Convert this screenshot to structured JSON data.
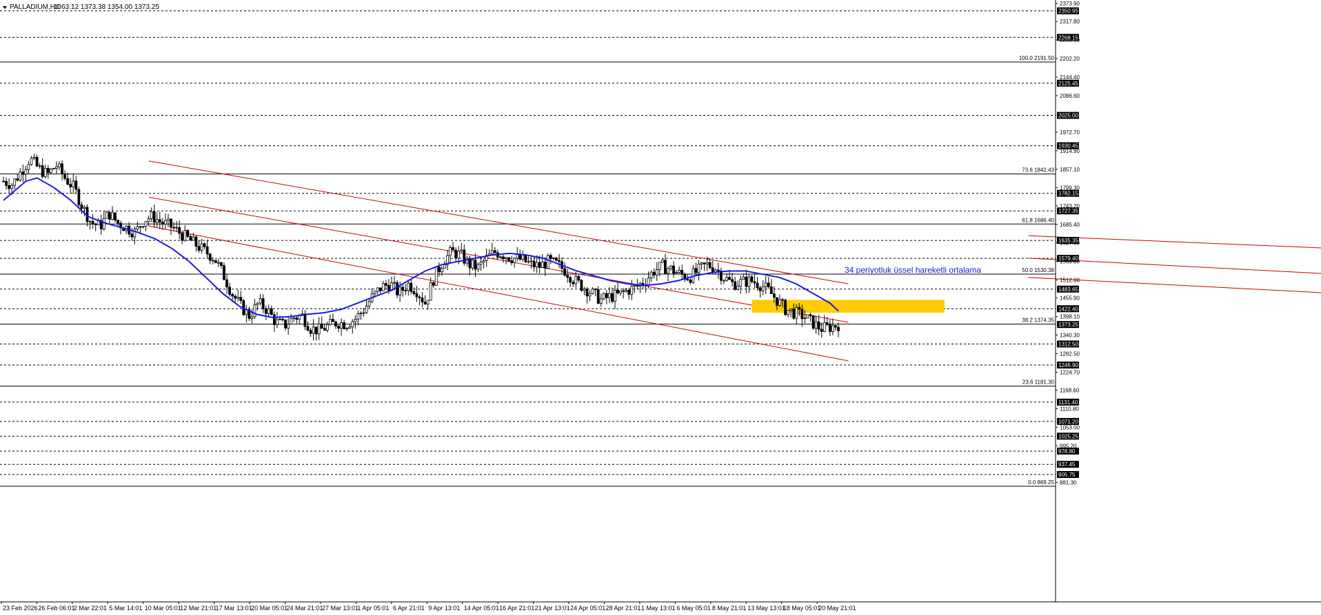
{
  "header": {
    "symbol": "PALLADIUM,H4",
    "ohlc": "1363.12 1373.38 1354.00 1373.25"
  },
  "annotation": {
    "text": "34 periyotluk üssel hareketli ortalama",
    "color": "#1a1adc"
  },
  "colors": {
    "candle": "#000000",
    "ema": "#1a1adc",
    "channel": "#cc0000",
    "zone": "#ffcc00",
    "grid": "#000000"
  },
  "chart_data": {
    "type": "candlestick",
    "title": "",
    "ylim": [
      869.25,
      2373.9
    ],
    "price_ticks": [
      "2373.90",
      "2317.80",
      "2260.00",
      "2202.20",
      "2144.40",
      "2086.60",
      "1972.70",
      "1914.90",
      "1857.10",
      "1799.30",
      "1743.20",
      "1685.40",
      "1627.60",
      "1569.80",
      "1512.00",
      "1455.90",
      "1398.10",
      "1340.30",
      "1282.50",
      "1224.70",
      "1168.60",
      "1110.80",
      "1053.00",
      "995.20",
      "881.30"
    ],
    "date_labels": [
      "23 Feb 2026",
      "26 Feb 06:01",
      "2 Mar 22:01",
      "5 Mar 14:01",
      "10 Mar 05:01",
      "12 Mar 21:01",
      "17 Mar 13:01",
      "20 Mar 05:01",
      "24 Mar 21:01",
      "27 Mar 13:01",
      "1 Apr 05:01",
      "6 Apr 21:01",
      "9 Apr 13:01",
      "14 Apr 05:01",
      "16 Apr 21:01",
      "21 Apr 13:01",
      "24 Apr 05:01",
      "28 Apr 21:01",
      "1 May 13:01",
      "6 May 05:01",
      "8 May 21:01",
      "13 May 13:01",
      "18 May 05:01",
      "20 May 21:01"
    ],
    "horizontal_levels": [
      {
        "price": 2350.95,
        "label": "2350.95",
        "style": "dashed",
        "badge": true
      },
      {
        "price": 2268.15,
        "label": "2268.15",
        "style": "dashed",
        "badge": true
      },
      {
        "price": 2191.5,
        "label": "100.0 2191.50",
        "style": "solid",
        "badge": false
      },
      {
        "price": 2125.45,
        "label": "2125.45",
        "style": "dashed",
        "badge": true
      },
      {
        "price": 2025.0,
        "label": "2025.00",
        "style": "dashed",
        "badge": true
      },
      {
        "price": 1930.45,
        "label": "1930.45",
        "style": "dashed",
        "badge": true
      },
      {
        "price": 1842.43,
        "label": "73.6 1842.43",
        "style": "solid",
        "badge": false
      },
      {
        "price": 1782.15,
        "label": "1782.15",
        "style": "dashed",
        "badge": true
      },
      {
        "price": 1727.35,
        "label": "1727.35",
        "style": "dashed",
        "badge": true
      },
      {
        "price": 1686.4,
        "label": "61.8 1686.40",
        "style": "solid",
        "badge": false
      },
      {
        "price": 1635.35,
        "label": "1635.35",
        "style": "dashed",
        "badge": true
      },
      {
        "price": 1579.4,
        "label": "1579.40",
        "style": "dashed",
        "badge": true
      },
      {
        "price": 1530.38,
        "label": "50.0 1530.38",
        "style": "solid",
        "badge": false
      },
      {
        "price": 1483.65,
        "label": "1483.65",
        "style": "dashed",
        "badge": true
      },
      {
        "price": 1422.4,
        "label": "1422.40",
        "style": "dashed",
        "badge": true
      },
      {
        "price": 1374.35,
        "label": "38.2 1374.35",
        "style": "solid",
        "badge": false
      },
      {
        "price": 1312.5,
        "label": "1312.50",
        "style": "dashed",
        "badge": true
      },
      {
        "price": 1246.9,
        "label": "1246.90",
        "style": "dashed",
        "badge": true
      },
      {
        "price": 1181.3,
        "label": "23.6 1181.30",
        "style": "solid",
        "badge": false
      },
      {
        "price": 1131.4,
        "label": "1131.40",
        "style": "dashed",
        "badge": true
      },
      {
        "price": 1071.2,
        "label": "1071.20",
        "style": "dashed",
        "badge": true
      },
      {
        "price": 1025.25,
        "label": "1025.25",
        "style": "dashed",
        "badge": true
      },
      {
        "price": 978.8,
        "label": "978.80",
        "style": "dashed",
        "badge": true
      },
      {
        "price": 937.45,
        "label": "937.45",
        "style": "dashed",
        "badge": true
      },
      {
        "price": 905.75,
        "label": "905.75",
        "style": "dashed",
        "badge": true
      },
      {
        "price": 869.25,
        "label": "0.0 869.25",
        "style": "solid",
        "badge": false
      }
    ],
    "current_price": "1373.25",
    "close_path": [
      1820,
      1810,
      1850,
      1890,
      1860,
      1840,
      1870,
      1830,
      1800,
      1740,
      1690,
      1680,
      1720,
      1690,
      1675,
      1660,
      1700,
      1710,
      1690,
      1680,
      1660,
      1640,
      1620,
      1600,
      1580,
      1530,
      1470,
      1430,
      1400,
      1440,
      1420,
      1380,
      1370,
      1395,
      1400,
      1360,
      1355,
      1370,
      1380,
      1375,
      1390,
      1420,
      1460,
      1490,
      1500,
      1470,
      1500,
      1480,
      1440,
      1520,
      1570,
      1600,
      1590,
      1560,
      1550,
      1580,
      1600,
      1590,
      1580,
      1575,
      1560,
      1555,
      1570,
      1560,
      1540,
      1510,
      1490,
      1470,
      1450,
      1460,
      1465,
      1480,
      1490,
      1510,
      1540,
      1555,
      1545,
      1530,
      1520,
      1540,
      1560,
      1550,
      1520,
      1500,
      1505,
      1510,
      1500,
      1480,
      1450,
      1420,
      1410,
      1400,
      1380,
      1360,
      1365,
      1373
    ],
    "ema_period": 34,
    "ema_points": [
      [
        0,
        1760
      ],
      [
        4,
        1790
      ],
      [
        8,
        1820
      ],
      [
        12,
        1830
      ],
      [
        18,
        1800
      ],
      [
        24,
        1760
      ],
      [
        30,
        1710
      ],
      [
        36,
        1690
      ],
      [
        42,
        1675
      ],
      [
        48,
        1660
      ],
      [
        54,
        1640
      ],
      [
        60,
        1610
      ],
      [
        66,
        1570
      ],
      [
        72,
        1520
      ],
      [
        78,
        1470
      ],
      [
        84,
        1430
      ],
      [
        90,
        1405
      ],
      [
        96,
        1395
      ],
      [
        102,
        1398
      ],
      [
        108,
        1405
      ],
      [
        114,
        1410
      ],
      [
        120,
        1420
      ],
      [
        126,
        1440
      ],
      [
        132,
        1460
      ],
      [
        138,
        1480
      ],
      [
        144,
        1510
      ],
      [
        150,
        1540
      ],
      [
        156,
        1560
      ],
      [
        162,
        1570
      ],
      [
        168,
        1580
      ],
      [
        174,
        1590
      ],
      [
        180,
        1595
      ],
      [
        186,
        1590
      ],
      [
        192,
        1580
      ],
      [
        198,
        1560
      ],
      [
        204,
        1540
      ],
      [
        210,
        1525
      ],
      [
        216,
        1510
      ],
      [
        222,
        1500
      ],
      [
        228,
        1495
      ],
      [
        234,
        1500
      ],
      [
        240,
        1510
      ],
      [
        246,
        1525
      ],
      [
        252,
        1535
      ],
      [
        258,
        1540
      ],
      [
        264,
        1540
      ],
      [
        270,
        1530
      ],
      [
        276,
        1520
      ],
      [
        282,
        1500
      ],
      [
        288,
        1470
      ],
      [
        294,
        1440
      ],
      [
        297,
        1415
      ]
    ],
    "channels": [
      {
        "name": "down-channel",
        "lines": [
          [
            [
              21,
              1883
            ],
            [
              122,
              1500
            ]
          ],
          [
            [
              21,
              1770
            ],
            [
              122,
              1380
            ]
          ],
          [
            [
              21,
              1680
            ],
            [
              122,
              1260
            ]
          ]
        ]
      },
      {
        "name": "flat-channel",
        "lines": [
          [
            [
              148,
              1650
            ],
            [
              237,
              1570
            ]
          ],
          [
            [
              148,
              1580
            ],
            [
              237,
              1480
            ]
          ],
          [
            [
              148,
              1520
            ],
            [
              237,
              1420
            ]
          ]
        ]
      }
    ],
    "zone": {
      "price_top": 1450,
      "price_bottom": 1410,
      "index_start": 268,
      "index_end": 337
    },
    "total_bars": 300
  }
}
